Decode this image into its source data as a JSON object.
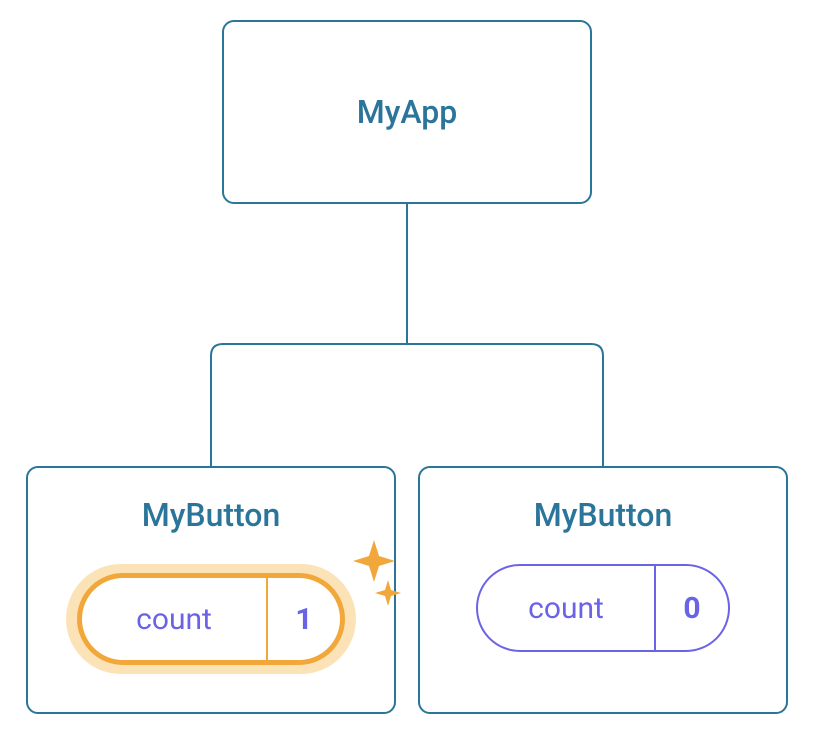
{
  "root": {
    "label": "MyApp"
  },
  "children": [
    {
      "label": "MyButton",
      "state_label": "count",
      "state_value": "1",
      "highlighted": true
    },
    {
      "label": "MyButton",
      "state_label": "count",
      "state_value": "0",
      "highlighted": false
    }
  ],
  "colors": {
    "node_border": "#2a7599",
    "node_text": "#2a7599",
    "pill_border": "#6b63e6",
    "pill_text": "#6b63e6",
    "highlight": "#f2a73b",
    "highlight_glow": "#fbe3b7"
  }
}
